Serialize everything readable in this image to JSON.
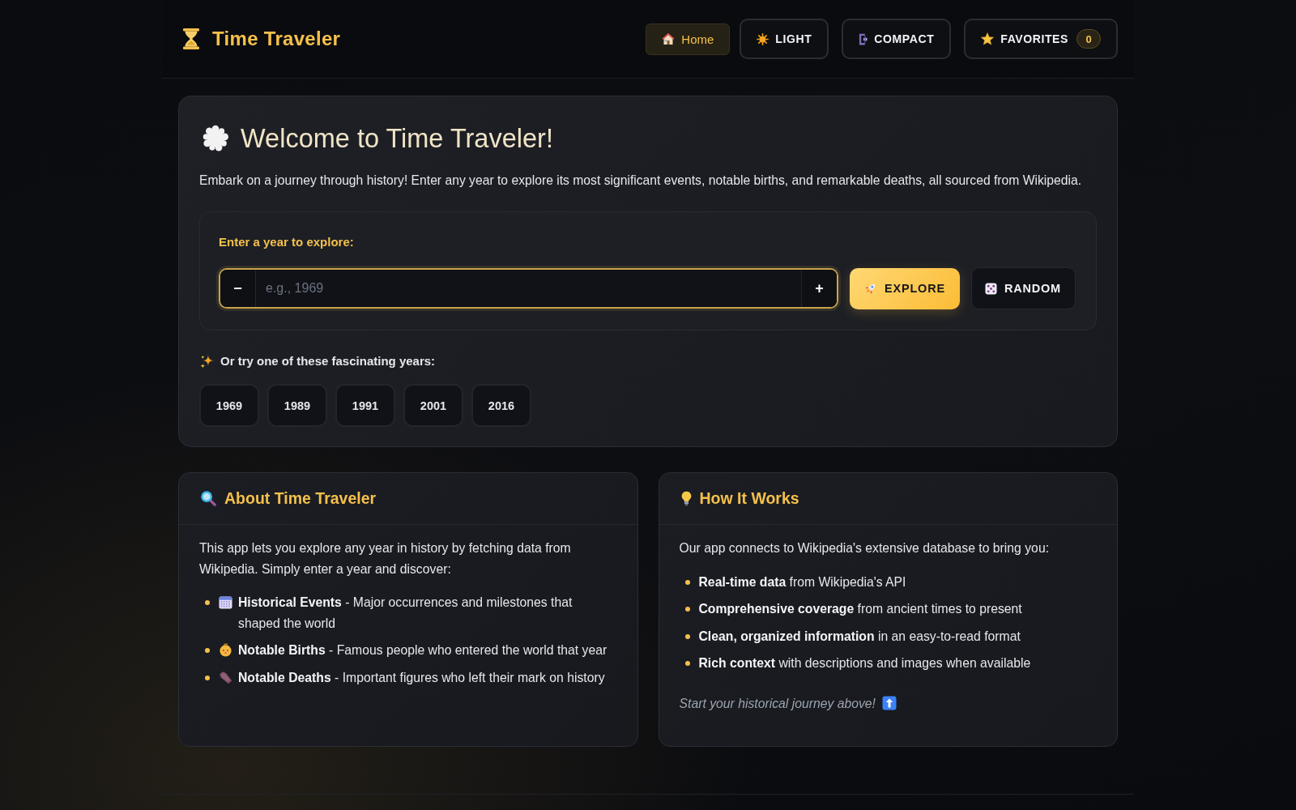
{
  "header": {
    "logo": "Time Traveler",
    "nav": [
      {
        "label": "Home",
        "selected": true
      },
      {
        "label": "LIGHT",
        "selected": false
      },
      {
        "label": "COMPACT",
        "selected": false
      },
      {
        "label": "FAVORITES",
        "selected": false,
        "count": "0"
      }
    ]
  },
  "welcome": {
    "title": "Welcome to Time Traveler!",
    "description": "Embark on a journey through history! Enter any year to explore its most significant events, notable births, and remarkable deaths, all sourced from Wikipedia.",
    "year_form": {
      "label": "Enter a year to explore:",
      "decrement": "−",
      "placeholder": "e.g., 1969",
      "increment": "+",
      "actions": [
        {
          "label": "EXPLORE",
          "kind": "primary"
        },
        {
          "label": "RANDOM",
          "kind": "secondary"
        }
      ]
    },
    "suggestions": {
      "label": "Or try one of these fascinating years:",
      "years": [
        "1969",
        "1989",
        "1991",
        "2001",
        "2016"
      ]
    }
  },
  "cards": [
    {
      "title": "About Time Traveler",
      "intro": "This app lets you explore any year in history by fetching data from Wikipedia. Simply enter a year and discover:",
      "items": [
        "**Historical Events** - Major occurrences and milestones that shaped the world",
        "**Notable Births** - Famous people who entered the world that year",
        "**Notable Deaths** - Important figures who left their mark on history"
      ]
    },
    {
      "title": "How It Works",
      "intro": "Our app connects to Wikipedia's extensive database to bring you:",
      "items": [
        "**Real-time data** from Wikipedia's API",
        "**Comprehensive coverage** from ancient times to present",
        "**Clean, organized information** in an easy-to-read format",
        "**Rich context** with descriptions and images when available"
      ],
      "note": "Start your historical journey above!"
    }
  ]
}
